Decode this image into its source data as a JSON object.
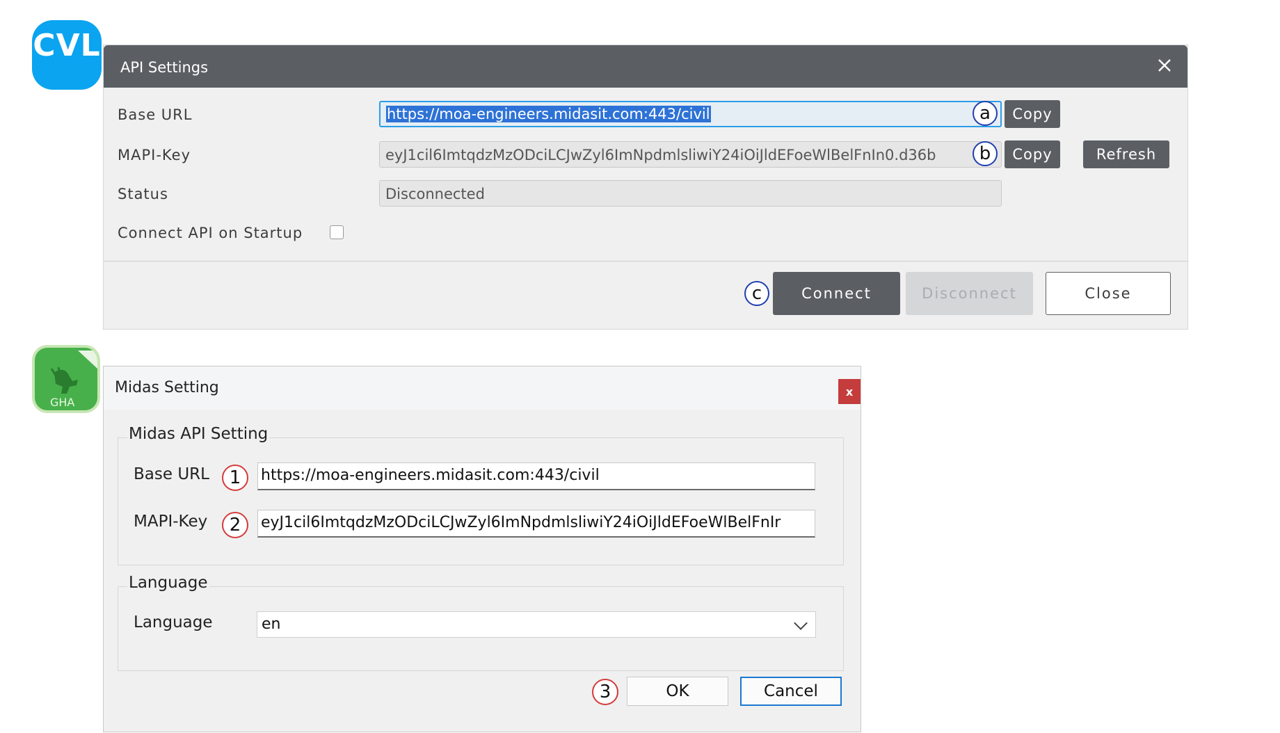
{
  "cvl_badge": {
    "text": "CVL",
    "color": "#0aa4f0"
  },
  "api_dialog": {
    "title": "API Settings",
    "titlebar_color": "#5b5f64",
    "close_icon": "close-icon",
    "base_url": {
      "label": "Base URL",
      "value": "https://moa-engineers.midasit.com:443/civil",
      "copy_label": "Copy",
      "marker": "a"
    },
    "mapi_key": {
      "label": "MAPI-Key",
      "value": "eyJ1cil6ImtqdzMzODciLCJwZyl6ImNpdmlsliwiY24iOiJldEFoeWlBelFnIn0.d36b",
      "copy_label": "Copy",
      "refresh_label": "Refresh",
      "marker": "b"
    },
    "status": {
      "label": "Status",
      "value": "Disconnected"
    },
    "startup": {
      "label": "Connect API on Startup",
      "checked": false
    },
    "buttons": {
      "connect": "Connect",
      "disconnect": "Disconnect",
      "close": "Close",
      "marker": "c"
    }
  },
  "gha_badge": {
    "text": "GHA",
    "color": "#47b04b"
  },
  "midas_dialog": {
    "title": "Midas Setting",
    "close_label": "x",
    "api_group": {
      "legend": "Midas API Setting",
      "base_url": {
        "label": "Base URL",
        "value": "https://moa-engineers.midasit.com:443/civil",
        "marker": "1"
      },
      "mapi_key": {
        "label": "MAPI-Key",
        "value": "eyJ1cil6ImtqdzMzODciLCJwZyl6ImNpdmlsliwiY24iOiJldEFoeWlBelFnIr",
        "marker": "2"
      }
    },
    "language_group": {
      "legend": "Language",
      "label": "Language",
      "value": "en"
    },
    "buttons": {
      "ok": "OK",
      "cancel": "Cancel",
      "marker": "3"
    }
  }
}
